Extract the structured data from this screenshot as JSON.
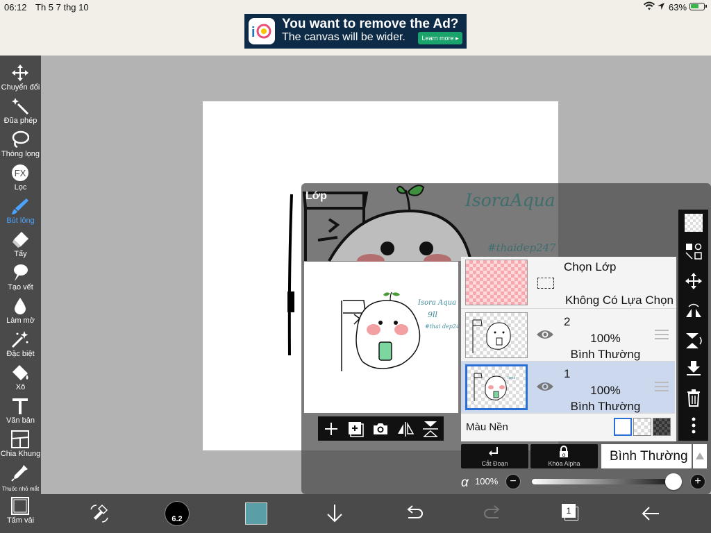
{
  "status": {
    "time": "06:12",
    "date": "Th 5 7 thg 10",
    "battery": "63%",
    "battery_level": 0.63
  },
  "ad": {
    "headline": "You want to remove the Ad?",
    "subline": "The canvas will be wider.",
    "button": "Learn more ▸"
  },
  "tools": [
    {
      "name": "move-tool",
      "icon": "move-arrows-icon",
      "label": "Chuyển đổi"
    },
    {
      "name": "magic-wand-tool",
      "icon": "magic-wand-icon",
      "label": "Đũa phép"
    },
    {
      "name": "lasso-tool",
      "icon": "lasso-icon",
      "label": "Thòng lọng"
    },
    {
      "name": "filter-tool",
      "icon": "fx-icon",
      "label": "Lọc"
    },
    {
      "name": "brush-tool",
      "icon": "brush-icon",
      "label": "Bút lông",
      "active": true
    },
    {
      "name": "eraser-tool",
      "icon": "eraser-icon",
      "label": "Tẩy"
    },
    {
      "name": "smudge-tool",
      "icon": "smudge-icon",
      "label": "Tạo vết"
    },
    {
      "name": "blur-tool",
      "icon": "drop-icon",
      "label": "Làm mờ"
    },
    {
      "name": "special-tool",
      "icon": "sparkle-wand-icon",
      "label": "Đặc biệt"
    },
    {
      "name": "fill-tool",
      "icon": "bucket-icon",
      "label": "Xô"
    },
    {
      "name": "text-tool",
      "icon": "text-t-icon",
      "label": "Văn bản"
    },
    {
      "name": "frame-divider-tool",
      "icon": "frame-divider-icon",
      "label": "Chia Khung"
    },
    {
      "name": "eyedropper-tool",
      "icon": "eyedropper-icon",
      "label": "Thuốc nhỏ mắt"
    },
    {
      "name": "canvas-tool",
      "icon": "canvas-icon",
      "label": "Tấm vải"
    }
  ],
  "panel": {
    "title": "Lớp"
  },
  "artwork": {
    "signature": "IsoraAqua",
    "tag": "#thaidep247"
  },
  "layers": {
    "selection": {
      "title": "Chọn Lớp",
      "status": "Không Có Lựa Chọn"
    },
    "rows": [
      {
        "number": "2",
        "opacity": "100%",
        "mode": "Bình Thường",
        "selected": false
      },
      {
        "number": "1",
        "opacity": "100%",
        "mode": "Bình Thường",
        "selected": true
      }
    ],
    "background_label": "Màu Nền"
  },
  "controls": {
    "clipping_label": "Cắt Đoạn",
    "alpha_lock_label": "Khóa Alpha",
    "blend_mode": "Bình Thường",
    "alpha_symbol": "α",
    "opacity": "100%",
    "opacity_value": 1.0,
    "minus": "−",
    "plus": "+"
  },
  "bottom": {
    "brush_size": "6.2",
    "color": "#5a9ea8",
    "layer_count": "1"
  },
  "colors": {
    "accent": "#4aa3ff",
    "toolbar": "#4a4a4a",
    "selected_row": "#cbd8ee"
  }
}
